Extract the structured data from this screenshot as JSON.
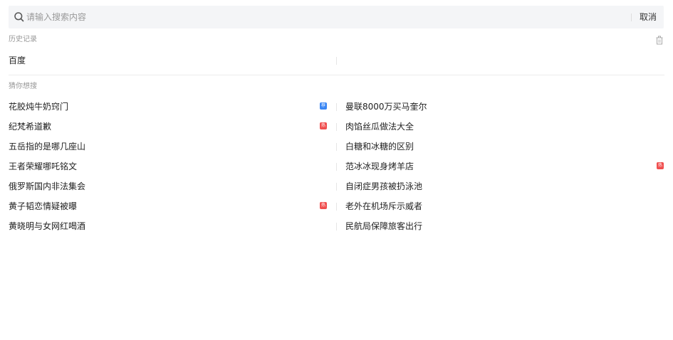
{
  "search": {
    "placeholder": "请输入搜索内容",
    "value": "",
    "cancel_label": "取消"
  },
  "history": {
    "title": "历史记录",
    "items": [
      "百度"
    ]
  },
  "suggest": {
    "title": "猜你想搜",
    "rows": [
      {
        "left": {
          "text": "花胶炖牛奶窍门",
          "badge": "荐",
          "badge_color": "#3a86f4"
        },
        "right": {
          "text": "曼联8000万买马奎尔",
          "badge": "",
          "badge_color": ""
        }
      },
      {
        "left": {
          "text": "纪梵希道歉",
          "badge": "热",
          "badge_color": "#f04f4f"
        },
        "right": {
          "text": "肉馅丝瓜做法大全",
          "badge": "",
          "badge_color": ""
        }
      },
      {
        "left": {
          "text": "五岳指的是哪几座山",
          "badge": "",
          "badge_color": ""
        },
        "right": {
          "text": "白糖和冰糖的区别",
          "badge": "",
          "badge_color": ""
        }
      },
      {
        "left": {
          "text": "王者荣耀哪吒铭文",
          "badge": "",
          "badge_color": ""
        },
        "right": {
          "text": "范冰冰现身烤羊店",
          "badge": "热",
          "badge_color": "#f04f4f"
        }
      },
      {
        "left": {
          "text": "俄罗斯国内非法集会",
          "badge": "",
          "badge_color": ""
        },
        "right": {
          "text": "自闭症男孩被扔泳池",
          "badge": "",
          "badge_color": ""
        }
      },
      {
        "left": {
          "text": "黄子韬恋情疑被曝",
          "badge": "热",
          "badge_color": "#f04f4f"
        },
        "right": {
          "text": "老外在机场斥示威者",
          "badge": "",
          "badge_color": ""
        }
      },
      {
        "left": {
          "text": "黄晓明与女网红喝酒",
          "badge": "",
          "badge_color": ""
        },
        "right": {
          "text": "民航局保障旅客出行",
          "badge": "",
          "badge_color": ""
        }
      }
    ]
  },
  "icons": {
    "search": "search-icon",
    "trash": "trash-icon"
  },
  "colors": {
    "search_bg": "#f4f5f7",
    "hot_badge": "#f04f4f",
    "recommend_badge": "#3a86f4",
    "section_title": "#999999"
  }
}
